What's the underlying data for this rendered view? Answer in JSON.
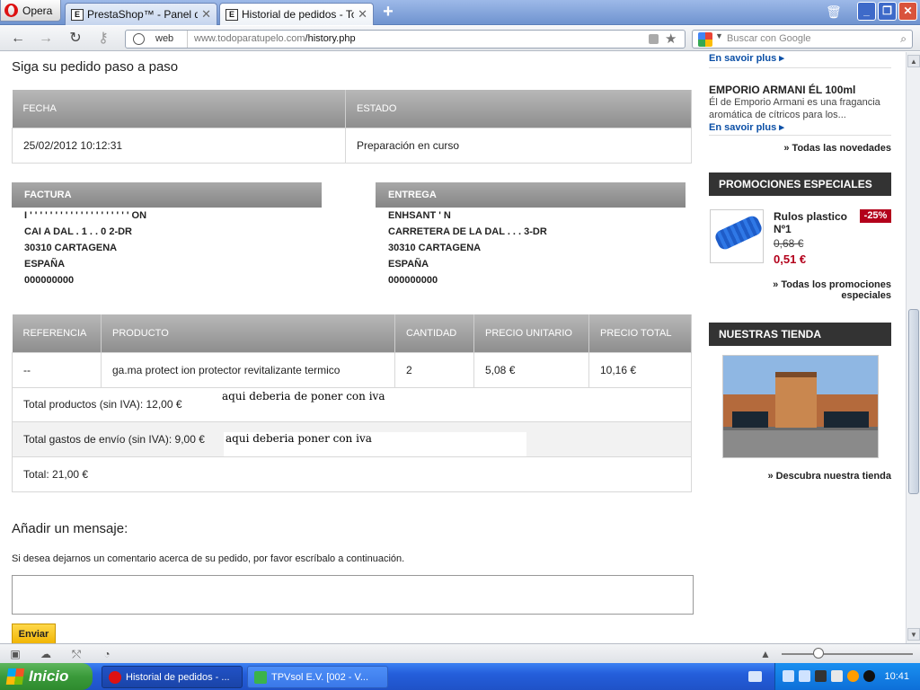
{
  "browser": {
    "opera_label": "Opera",
    "tabs": [
      {
        "title": "PrestaShop™ - Panel de ...",
        "active": false
      },
      {
        "title": "Historial de pedidos - To...",
        "active": true
      }
    ],
    "address": {
      "scheme": "web",
      "url_host": "www.todoparatupelo.com",
      "url_path": "/history.php"
    },
    "search_placeholder": "Buscar con Google"
  },
  "page": {
    "track_title": "Siga su pedido paso a paso",
    "status_table": {
      "headers": [
        "FECHA",
        "ESTADO"
      ],
      "row": [
        "25/02/2012 10:12:31",
        "Preparación en curso"
      ]
    },
    "invoice": {
      "heading": "FACTURA",
      "lines": [
        "I ' ' ' ' ' ' ' ' ' ' ' ' ' ' ' ' ' ' ' ' ON",
        "CAI                    A DAL  . 1 . . 0 2-DR",
        "30310 CARTAGENA",
        "ESPAÑA",
        "000000000"
      ]
    },
    "delivery": {
      "heading": "ENTREGA",
      "lines": [
        "ENHSANT                     '              N",
        "CARRETERA DE LA DAL . .  .     3-DR",
        "30310 CARTAGENA",
        "ESPAÑA",
        "000000000"
      ]
    },
    "products_table": {
      "headers": [
        "REFERENCIA",
        "PRODUCTO",
        "CANTIDAD",
        "PRECIO UNITARIO",
        "PRECIO TOTAL"
      ],
      "row": [
        "--",
        "ga.ma protect ion protector revitalizante termico",
        "2",
        "5,08 €",
        "10,16 €"
      ]
    },
    "totals": {
      "products": "Total productos (sin IVA): 12,00 €",
      "shipping": "Total gastos de envío (sin IVA): 9,00 €",
      "total": "Total: 21,00 €"
    },
    "notes": {
      "note1": "aqui deberia de poner con iva",
      "note2": "aqui deberia poner con iva"
    },
    "message": {
      "heading": "Añadir un mensaje:",
      "hint": "Si desea dejarnos un comentario acerca de su pedido, por favor escríbalo a continuación.",
      "send_label": "Enviar"
    }
  },
  "sidebar": {
    "more_link_top": "En savoir plus ▸",
    "novelty_name": "EMPORIO ARMANI ÉL 100ml",
    "novelty_desc": "Él de Emporio Armani es una fragancia aromática de cítricos para los...",
    "more_link": "En savoir plus ▸",
    "all_news": "» Todas las novedades",
    "promo_heading": "PROMOCIONES ESPECIALES",
    "promo_product": "Rulos plastico Nº1",
    "promo_discount": "-25%",
    "promo_old_price": "0,68 €",
    "promo_new_price": "0,51 €",
    "all_promos": "» Todas los promociones especiales",
    "store_heading": "NUESTRAS TIENDA",
    "store_link": "» Descubra nuestra tienda"
  },
  "taskbar": {
    "start_label": "Inicio",
    "tasks": [
      "Historial de pedidos - ...",
      "TPVsol E.V.  [002 - V..."
    ],
    "clock": "10:41"
  }
}
